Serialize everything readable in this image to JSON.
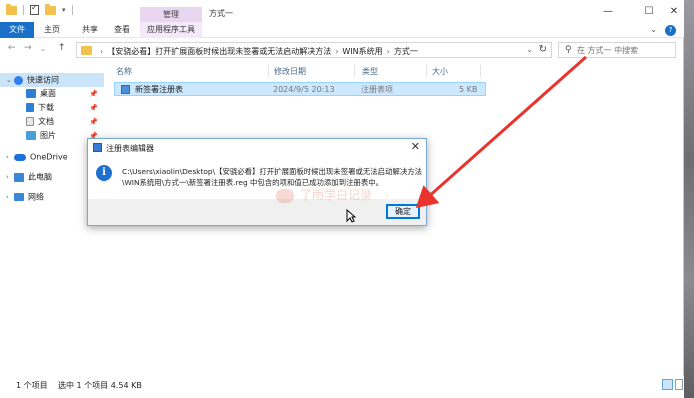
{
  "window": {
    "manage_tab": "管理",
    "title": "方式一"
  },
  "ribbon": {
    "file_tab": "文件",
    "tabs": [
      "主页",
      "共享",
      "查看"
    ],
    "app_tools_tab": "应用程序工具"
  },
  "address": {
    "crumbs": [
      "【安骁必看】打开扩展面板时候出现未签署或无法启动解决方法",
      "WIN系统用",
      "方式一"
    ],
    "search_placeholder": "在 方式一 中搜索"
  },
  "sidebar": {
    "items": [
      {
        "label": "快速访问",
        "icon": "star-icon",
        "color": "#2f80ed"
      },
      {
        "label": "桌面",
        "icon": "desktop-icon",
        "color": "#2d7fd3"
      },
      {
        "label": "下载",
        "icon": "download-icon",
        "color": "#2d7fd3"
      },
      {
        "label": "文档",
        "icon": "document-icon",
        "color": "#8a8a8a"
      },
      {
        "label": "图片",
        "icon": "picture-icon",
        "color": "#4a9fd8"
      },
      {
        "label": "OneDrive",
        "icon": "cloud-icon",
        "color": "#1e6fd9"
      },
      {
        "label": "此电脑",
        "icon": "computer-icon",
        "color": "#3a87d6"
      },
      {
        "label": "网络",
        "icon": "network-icon",
        "color": "#3a87d6"
      }
    ]
  },
  "list": {
    "columns": [
      "名称",
      "修改日期",
      "类型",
      "大小"
    ],
    "rows": [
      {
        "name": "新签署注册表",
        "date": "2024/9/5 20:13",
        "type": "注册表项",
        "size": "5 KB"
      }
    ]
  },
  "status": {
    "count": "1 个项目",
    "selected": "选中 1 个项目  4.54 KB"
  },
  "dialog": {
    "title": "注册表编辑器",
    "message_line1": "C:\\Users\\xiaolin\\Desktop\\【安骁必看】打开扩展面板时候出现未签署或无法启动解决方法",
    "message_line2": "\\WIN系统用\\方式一\\新签署注册表.reg 中包含的项和值已成功添加到注册表中。",
    "ok": "确定"
  },
  "watermark": "了雨学白记录",
  "colors": {
    "accent": "#0078d7",
    "file_tab": "#1a6fc9",
    "selection": "#cce8ff",
    "arrow": "#e8342c"
  }
}
